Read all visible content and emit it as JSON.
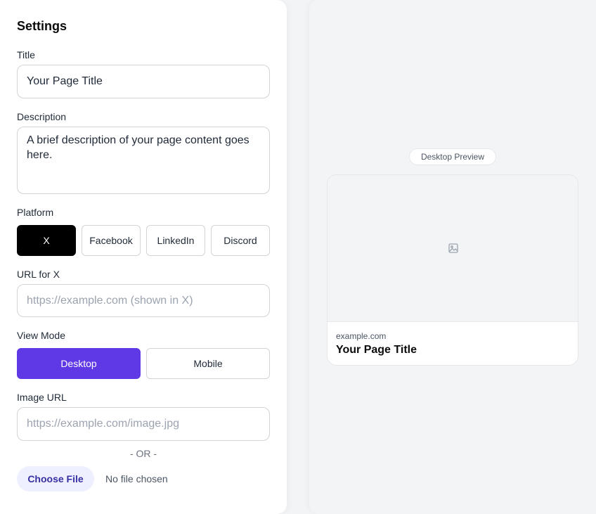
{
  "settings": {
    "title": "Settings",
    "fields": {
      "title_label": "Title",
      "title_value": "Your Page Title",
      "description_label": "Description",
      "description_value": "A brief description of your page content goes here.",
      "platform_label": "Platform",
      "url_label": "URL for X",
      "url_placeholder": "https://example.com (shown in X)",
      "view_mode_label": "View Mode",
      "image_url_label": "Image URL",
      "image_url_placeholder": "https://example.com/image.jpg",
      "or_divider": "- OR -",
      "choose_file_label": "Choose File",
      "file_status": "No file chosen"
    },
    "platforms": [
      {
        "label": "X",
        "active": true
      },
      {
        "label": "Facebook",
        "active": false
      },
      {
        "label": "LinkedIn",
        "active": false
      },
      {
        "label": "Discord",
        "active": false
      }
    ],
    "view_modes": [
      {
        "label": "Desktop",
        "active": true
      },
      {
        "label": "Mobile",
        "active": false
      }
    ]
  },
  "preview": {
    "badge": "Desktop Preview",
    "card": {
      "image_icon": "image-placeholder-icon",
      "domain": "example.com",
      "title": "Your Page Title"
    }
  },
  "colors": {
    "accent": "#6039e6",
    "platform_active_bg": "#000000",
    "choose_file_bg": "#eef0ff",
    "choose_file_text": "#3730a3"
  }
}
